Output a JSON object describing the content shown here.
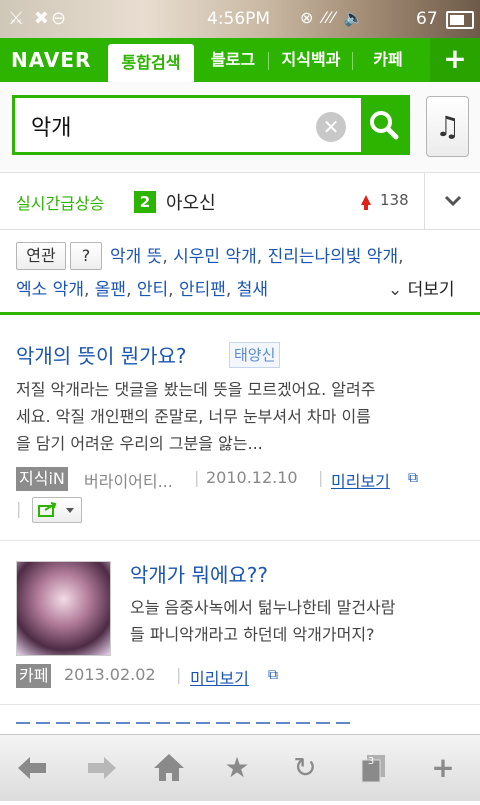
{
  "status_bar": {
    "time": "4:56PM",
    "battery": "67"
  },
  "header": {
    "logo": "NAVER",
    "tabs": [
      "통합검색",
      "블로그",
      "지식백과",
      "카페"
    ],
    "more_label": "+"
  },
  "search": {
    "query": "악개"
  },
  "realtime": {
    "label": "실시간급상승",
    "rank": "2",
    "keyword": "아오신",
    "count": "138"
  },
  "related": {
    "badge": "연관",
    "help": "?",
    "line1": [
      "악개 뜻",
      "시우민 악개",
      "진리는나의빛 악개"
    ],
    "line2": [
      "엑소 악개",
      "올팬",
      "안티",
      "안티팬",
      "철새"
    ],
    "more": "더보기"
  },
  "results": [
    {
      "title": "악개의 뜻이 뭔가요?",
      "tag": "태양신",
      "snippet_lines": [
        "저질 악개라는 댓글을 봤는데 뜻을 모르겠어요. 알려주",
        "세요. 악질 개인팬의 준말로, 너무 눈부셔서 차마 이름",
        "을 담기 어려운 우리의 그분을 앓는..."
      ],
      "source": "지식iN",
      "author": "버라이어티...",
      "date": "2010.12.10",
      "preview": "미리보기"
    },
    {
      "title": "악개가 뭐에요??",
      "snippet_lines": [
        "오늘 음중사녹에서 턺누나한테 말건사람",
        "들 파니악개라고 하던데 악개가머지?"
      ],
      "source": "카페",
      "date": "2013.02.02",
      "preview": "미리보기"
    }
  ],
  "colors": {
    "brand_green": "#2db400",
    "link_blue": "#1a55b4"
  },
  "bottom_bar_icons": [
    "back-icon",
    "forward-icon",
    "home-icon",
    "bookmark-star-icon",
    "refresh-icon",
    "tabs-icon",
    "add-icon"
  ],
  "tab_count": "3"
}
